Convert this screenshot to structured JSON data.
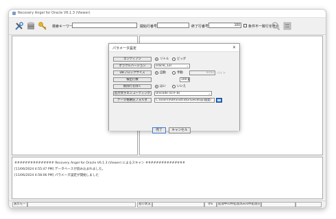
{
  "window": {
    "title": "Recovery Angel for Oracle V6.1.3 (Viewer)"
  },
  "toolbar": {
    "search_label": "検索キーワード",
    "search_value": "",
    "start_row_label": "開始行番号",
    "start_row_value": "",
    "end_row_label": "終了行番号",
    "end_row_value": "100",
    "not_matching_label": "条件不一致行を表示",
    "icons": [
      "tools-icon",
      "database-icon",
      "key-icon",
      "search-icon",
      "export-icon"
    ]
  },
  "dialog": {
    "title": "パラメータ設定",
    "close": "✕",
    "rows": [
      {
        "label": "エンディアン"
      },
      {
        "label": "オラクルバージョン"
      },
      {
        "label": "DBブロックサイズ"
      },
      {
        "label": "検出行数"
      },
      {
        "label": "削除行を除く"
      },
      {
        "label": "出力文字エンコーディング"
      },
      {
        "label": "データ格納先フォルダ"
      }
    ],
    "endian": {
      "options": [
        "リトル",
        "ビッグ"
      ],
      "selected": "リトル"
    },
    "oracle_version": {
      "value": "oracle_12c"
    },
    "block_size": {
      "options": [
        "自動",
        "手動"
      ],
      "selected": "自動",
      "manual_value": "8192",
      "unit": "バイト"
    },
    "detect_rows": {
      "value": "100"
    },
    "exclude_deleted": {
      "options": [
        "はい",
        "いいえ"
      ],
      "selected": "はい"
    },
    "encoding": {
      "value": "Unicode (UTF-8)"
    },
    "folder": {
      "value": "C:\\Users\\Administrator\\Desktop\\開発\\"
    },
    "ok_label": "完了",
    "cancel_label": "キャンセル"
  },
  "log": {
    "lines": [
      "############### Recovery Angel for Oracle V6.1.3 (Viewer) によるスキャン ###############",
      "",
      "[11/06/2024 4:55:47 PM] データベースが読み込まれました。",
      "[11/06/2024 4:58:06 PM] パラメータ設定が開始しました"
    ]
  },
  "status": {
    "cells": [
      "表示モード",
      "",
      "進行状況",
      "",
      "0%",
      "処理中(0件処理済み(0件処理完了))",
      "",
      ""
    ]
  }
}
